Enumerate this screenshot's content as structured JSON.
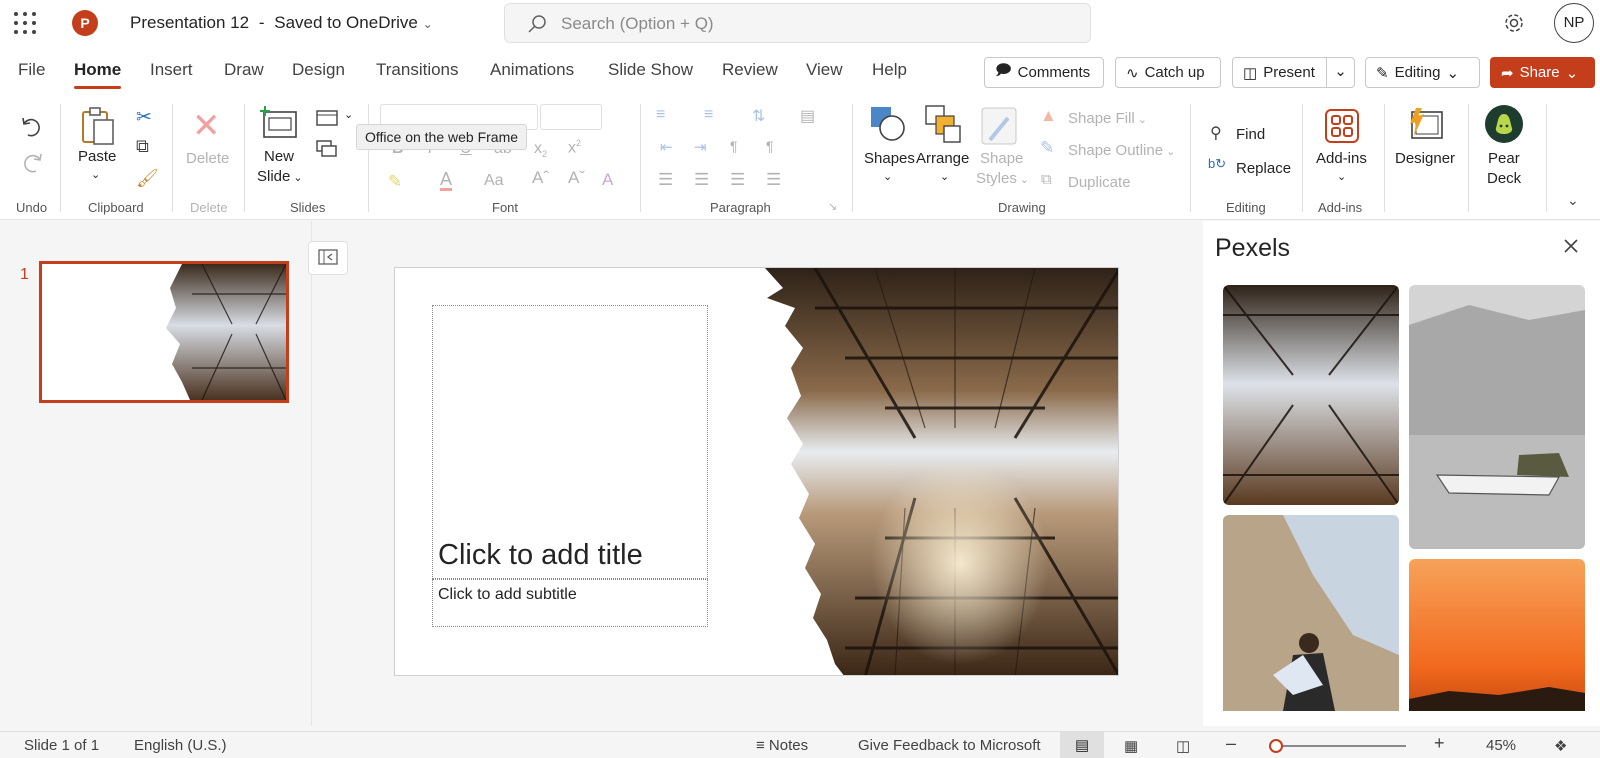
{
  "app": {
    "doc_title": "Presentation 12",
    "save_status": "Saved to OneDrive",
    "separator": "-",
    "logo_letter": "P",
    "brand_color": "#c43e1c"
  },
  "search": {
    "placeholder": "Search (Option + Q)"
  },
  "user": {
    "initials": "NP"
  },
  "menu": {
    "tabs": [
      "File",
      "Home",
      "Insert",
      "Draw",
      "Design",
      "Transitions",
      "Animations",
      "Slide Show",
      "Review",
      "View",
      "Help"
    ],
    "active": "Home",
    "comments": "Comments",
    "catchup": "Catch up",
    "present": "Present",
    "editing": "Editing",
    "share": "Share"
  },
  "ribbon": {
    "undo_group": "Undo",
    "paste": "Paste",
    "clipboard_group": "Clipboard",
    "delete": "Delete",
    "delete_group": "Delete",
    "new_slide_1": "New",
    "new_slide_2": "Slide",
    "slides_group": "Slides",
    "tooltip": "Office on the web Frame",
    "font_group": "Font",
    "paragraph_group": "Paragraph",
    "shapes": "Shapes",
    "arrange": "Arrange",
    "shape_styles_1": "Shape",
    "shape_styles_2": "Styles",
    "shape_fill": "Shape Fill",
    "shape_outline": "Shape Outline",
    "duplicate": "Duplicate",
    "drawing_group": "Drawing",
    "find": "Find",
    "replace": "Replace",
    "editing_group": "Editing",
    "addins": "Add-ins",
    "addins_group": "Add-ins",
    "designer": "Designer",
    "pear_1": "Pear",
    "pear_2": "Deck"
  },
  "slides_pane": {
    "slide_number": "1"
  },
  "slide": {
    "title_placeholder": "Click to add title",
    "subtitle_placeholder": "Click to add subtitle"
  },
  "pexels": {
    "title": "Pexels"
  },
  "status": {
    "slide_info": "Slide 1 of 1",
    "language": "English (U.S.)",
    "notes": "Notes",
    "feedback": "Give Feedback to Microsoft",
    "zoom": "45%",
    "zoom_level": 0.45
  }
}
